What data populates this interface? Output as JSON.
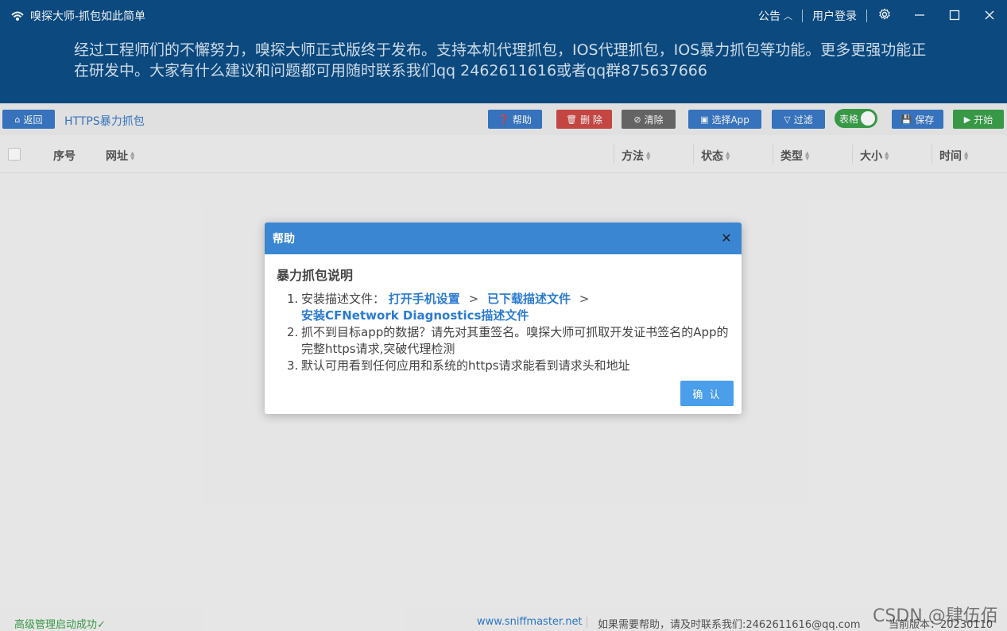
{
  "app": {
    "title": "嗅探大师-抓包如此简单"
  },
  "titlebar": {
    "announcement_label": "公告",
    "login_label": "用户登录"
  },
  "announcement": {
    "text": "经过工程师们的不懈努力，嗅探大师正式版终于发布。支持本机代理抓包，IOS代理抓包，IOS暴力抓包等功能。更多更强功能正在研发中。大家有什么建议和问题都可用随时联系我们qq 2462611616或者qq群875637666"
  },
  "toolbar": {
    "back": "返回",
    "breadcrumb": "HTTPS暴力抓包",
    "help": "帮助",
    "delete": "删 除",
    "clear": "清除",
    "select_app": "选择App",
    "filter": "过滤",
    "table_toggle": "表格",
    "save": "保存",
    "start": "开始"
  },
  "table": {
    "columns": [
      "序号",
      "网址",
      "方法",
      "状态",
      "类型",
      "大小",
      "时间"
    ],
    "rows": []
  },
  "modal": {
    "title": "帮助",
    "subtitle": "暴力抓包说明",
    "item1_prefix": "安装描述文件：",
    "item1_link1": "打开手机设置",
    "item1_link2": "已下载描述文件",
    "item1_link3": "安装CFNetwork Diagnostics描述文件",
    "item1_arrow": ">",
    "item2": "抓不到目标app的数据？请先对其重签名。嗅探大师可抓取开发证书签名的App的完整https请求,突破代理检测",
    "item3": "默认可用看到任何应用和系统的https请求能看到请求头和地址",
    "confirm": "确 认"
  },
  "statusbar": {
    "left": "高级管理启动成功",
    "check": "✓",
    "site": "www.sniffmaster.net",
    "help": "如果需要帮助，请及时联系我们:2462611616@qq.com",
    "version": "当前版本：20230110"
  },
  "watermark": "CSDN @肆伍佰",
  "colors": {
    "header_bg": "#0c4d86",
    "primary": "#3a79c7",
    "danger": "#cf4a47",
    "success": "#3aa14a",
    "modal_head": "#3a86d3"
  }
}
